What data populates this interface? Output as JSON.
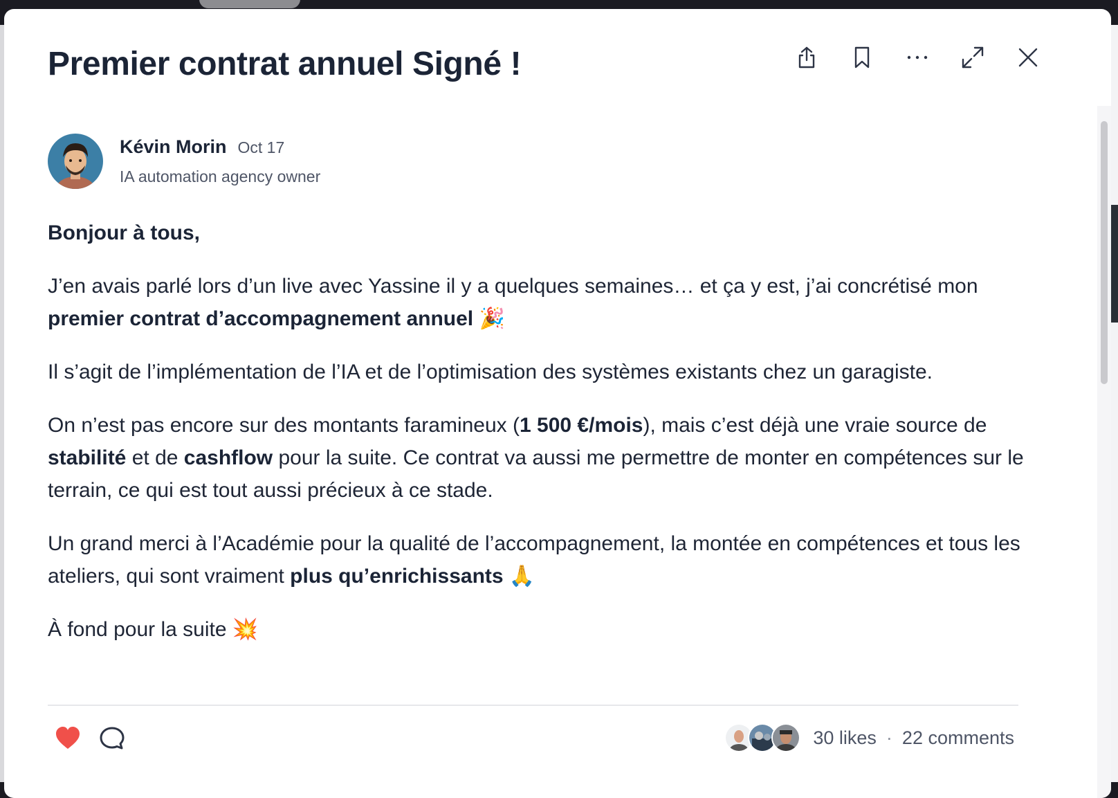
{
  "post": {
    "title": "Premier contrat annuel Signé !",
    "author": {
      "name": "Kévin Morin",
      "date": "Oct 17",
      "role": "IA automation agency owner"
    },
    "greeting": "Bonjour à tous,",
    "paragraphs": {
      "p1_text1": "J’en avais parlé lors d’un live avec Yassine il y a quelques semaines… et ça y est, j’ai concrétisé mon ",
      "p1_bold": "premier contrat d’accompagnement annuel",
      "p1_emoji": "🎉",
      "p2": "Il s’agit de l’implémentation de l’IA et de l’optimisation des systèmes existants chez un garagiste.",
      "p3_text1": "On n’est pas encore sur des montants faramineux (",
      "p3_bold1": "1 500 €/mois",
      "p3_text2": "), mais c’est déjà une vraie source de ",
      "p3_bold2": "stabilité",
      "p3_text3": " et de ",
      "p3_bold3": "cashflow",
      "p3_text4": " pour la suite. Ce contrat va aussi me permettre de monter en compétences sur le terrain, ce qui est tout aussi précieux à ce stade.",
      "p4_text1": "Un grand merci à l’Académie pour la qualité de l’accompagnement, la montée en compétences et tous les ateliers, qui sont vraiment ",
      "p4_bold": "plus qu’enrichissants",
      "p4_emoji": "🙏",
      "p5_text": "À fond pour la suite",
      "p5_emoji": "💥"
    },
    "stats": {
      "likes": "30 likes",
      "separator": "·",
      "comments": "22 comments"
    }
  },
  "toolbar": {
    "icons": [
      "share-icon",
      "bookmark-icon",
      "more-icon",
      "expand-icon",
      "close-icon"
    ]
  },
  "colors": {
    "like": "#f0504a",
    "text": "#1e2535",
    "muted": "#4e5566"
  }
}
